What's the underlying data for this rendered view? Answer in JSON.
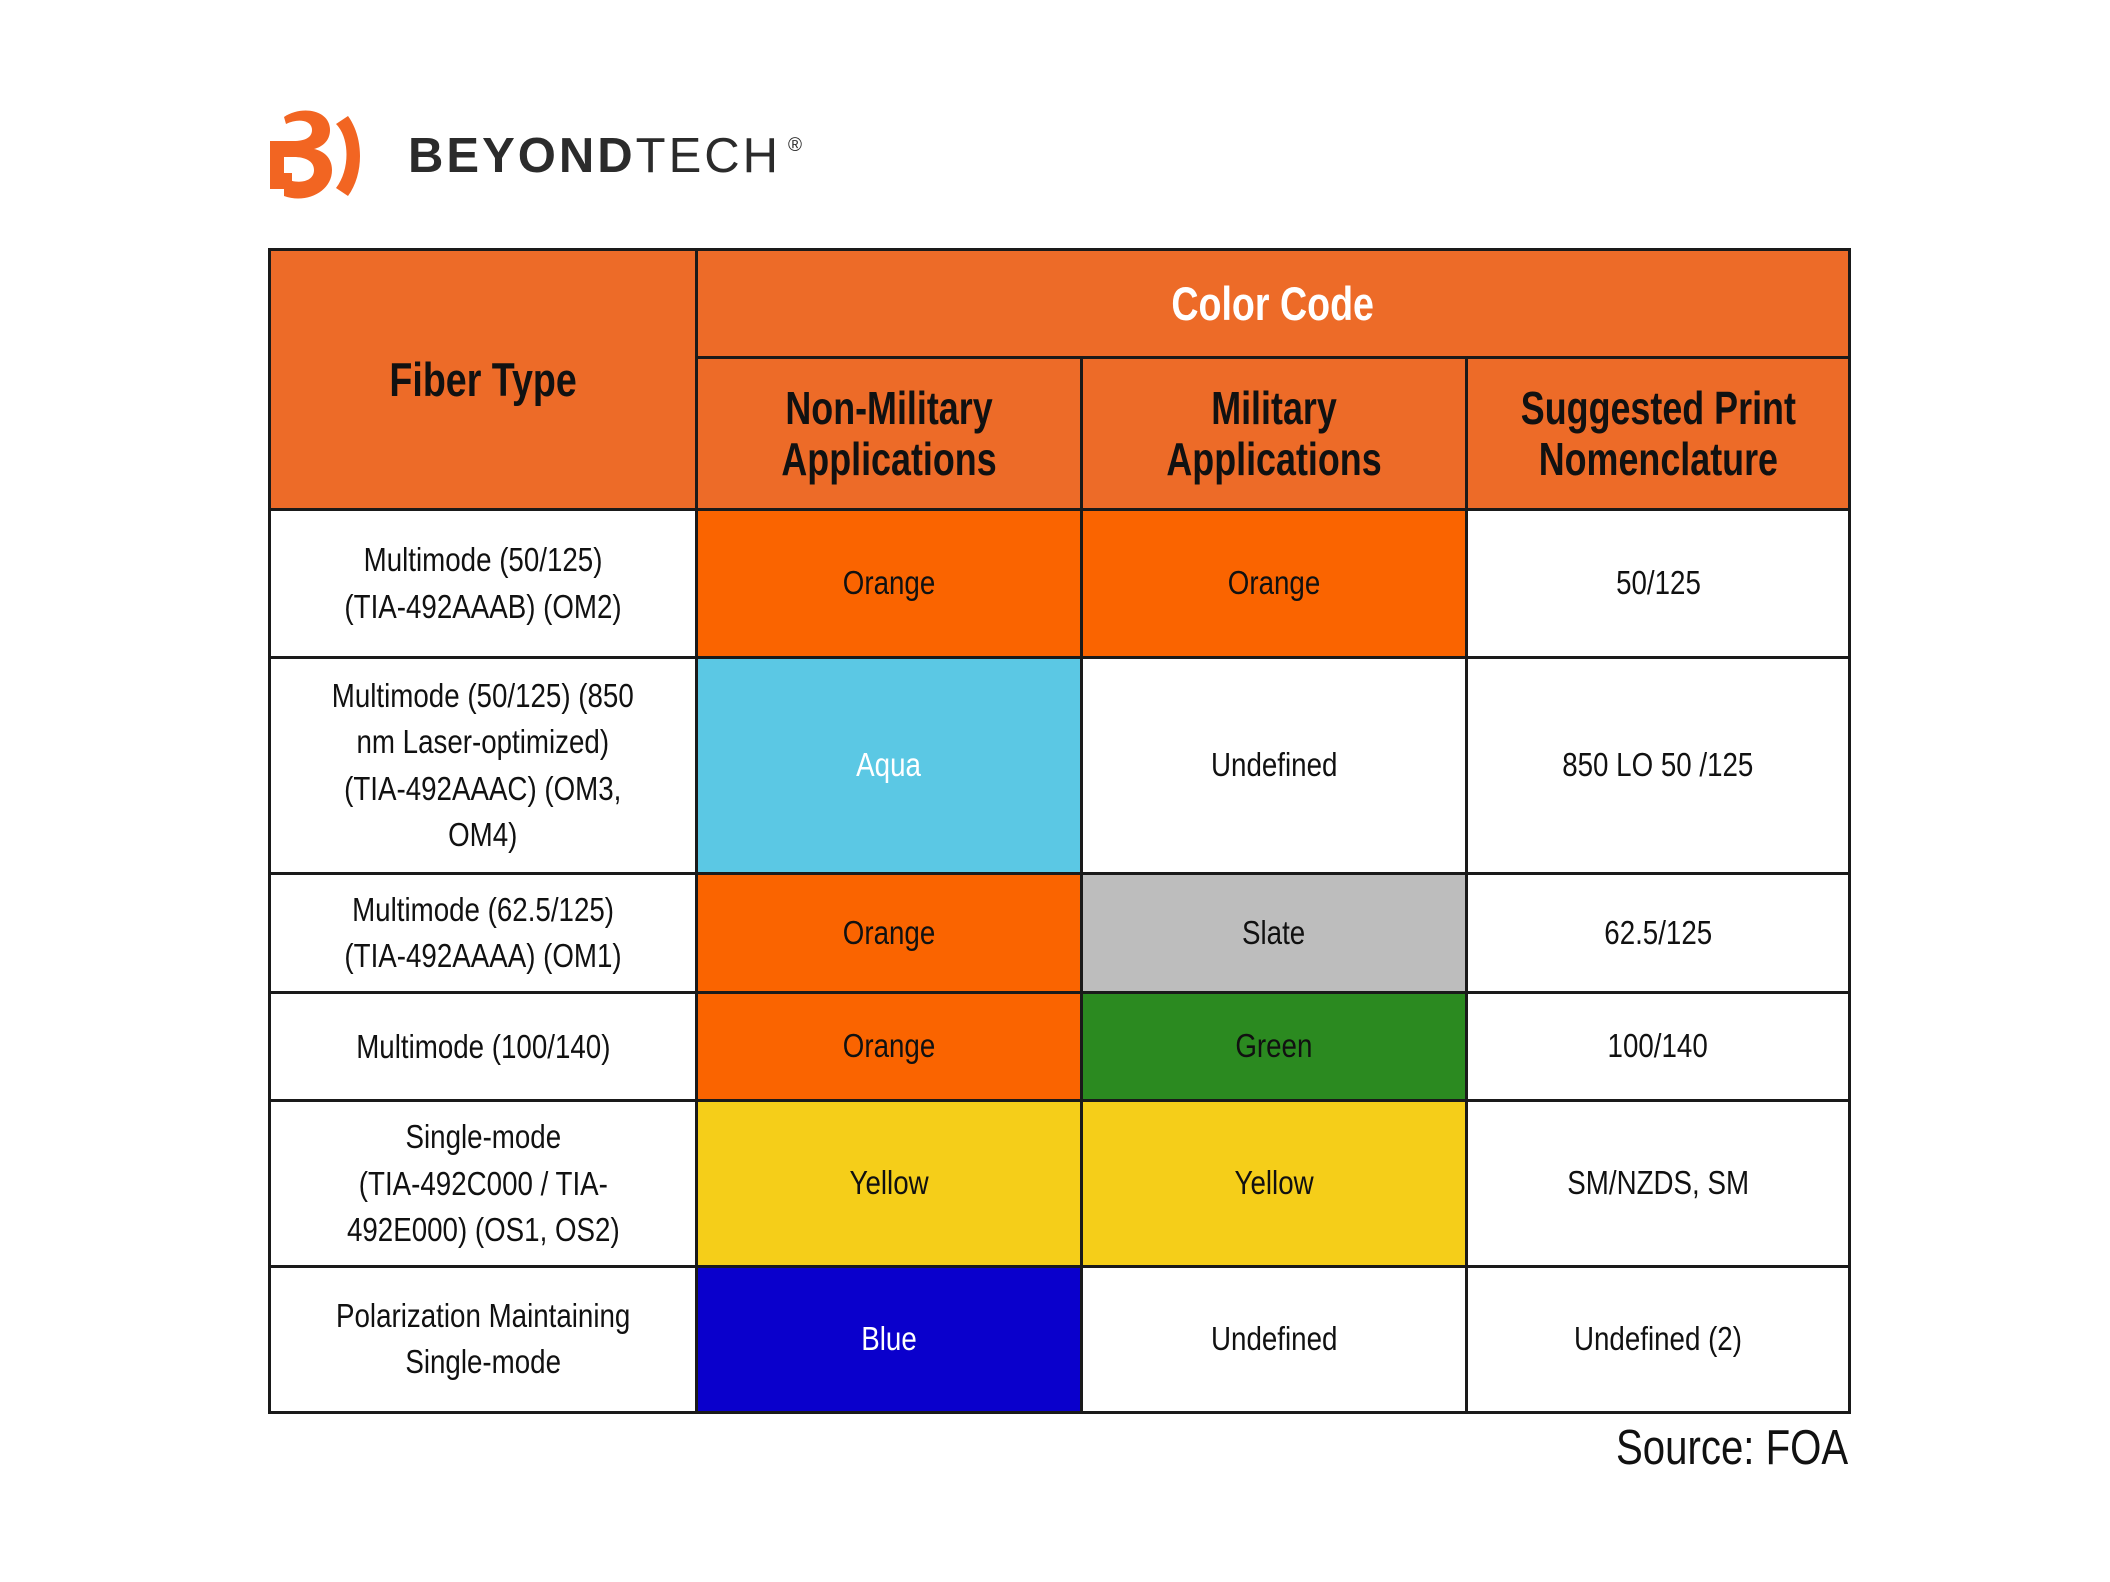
{
  "brand": {
    "logo_icon": "beyondtech-b-mark-icon",
    "name_bold": "BEYOND",
    "name_light": "TECH",
    "registered": "®",
    "accent_color": "#F26522"
  },
  "table": {
    "header": {
      "fiber_type": "Fiber Type",
      "color_code": "Color Code",
      "sub": {
        "non_military": "Non-Military\nApplications",
        "military": "Military\nApplications",
        "nomenclature": "Suggested Print\nNomenclature"
      },
      "bg_color": "#ED6B28",
      "color_code_text_color": "#FFFFFF",
      "text_color": "#111111"
    },
    "columns": [
      "Fiber Type",
      "Non-Military Applications",
      "Military Applications",
      "Suggested Print Nomenclature"
    ],
    "rows": [
      {
        "fiber_type": "Multimode (50/125)\n(TIA-492AAAB) (OM2)",
        "non_military": {
          "label": "Orange",
          "bg": "#FA6400",
          "fg": "#111111"
        },
        "military": {
          "label": "Orange",
          "bg": "#FA6400",
          "fg": "#111111"
        },
        "nomenclature": {
          "label": "50/125",
          "bg": "#FFFFFF",
          "fg": "#111111"
        }
      },
      {
        "fiber_type": "Multimode (50/125) (850\nnm Laser-optimized)\n(TIA-492AAAC) (OM3,\nOM4)",
        "non_military": {
          "label": "Aqua",
          "bg": "#5BC8E4",
          "fg": "#FFFFFF"
        },
        "military": {
          "label": "Undefined",
          "bg": "#FFFFFF",
          "fg": "#111111"
        },
        "nomenclature": {
          "label": "850 LO 50 /125",
          "bg": "#FFFFFF",
          "fg": "#111111"
        }
      },
      {
        "fiber_type": "Multimode (62.5/125)\n(TIA-492AAAA) (OM1)",
        "non_military": {
          "label": "Orange",
          "bg": "#FA6400",
          "fg": "#111111"
        },
        "military": {
          "label": "Slate",
          "bg": "#BDBDBD",
          "fg": "#111111"
        },
        "nomenclature": {
          "label": "62.5/125",
          "bg": "#FFFFFF",
          "fg": "#111111"
        }
      },
      {
        "fiber_type": "Multimode (100/140)",
        "non_military": {
          "label": "Orange",
          "bg": "#FA6400",
          "fg": "#111111"
        },
        "military": {
          "label": "Green",
          "bg": "#2B8A20",
          "fg": "#111111"
        },
        "nomenclature": {
          "label": "100/140",
          "bg": "#FFFFFF",
          "fg": "#111111"
        }
      },
      {
        "fiber_type": "Single-mode\n(TIA-492C000 / TIA-\n492E000) (OS1, OS2)",
        "non_military": {
          "label": "Yellow",
          "bg": "#F5CE19",
          "fg": "#111111"
        },
        "military": {
          "label": "Yellow",
          "bg": "#F5CE19",
          "fg": "#111111"
        },
        "nomenclature": {
          "label": "SM/NZDS, SM",
          "bg": "#FFFFFF",
          "fg": "#111111"
        }
      },
      {
        "fiber_type": "Polarization Maintaining\nSingle-mode",
        "non_military": {
          "label": "Blue",
          "bg": "#0A00CC",
          "fg": "#FFFFFF"
        },
        "military": {
          "label": "Undefined",
          "bg": "#FFFFFF",
          "fg": "#111111"
        },
        "nomenclature": {
          "label": "Undefined (2)",
          "bg": "#FFFFFF",
          "fg": "#111111"
        }
      }
    ]
  },
  "footer": {
    "source": "Source: FOA"
  }
}
